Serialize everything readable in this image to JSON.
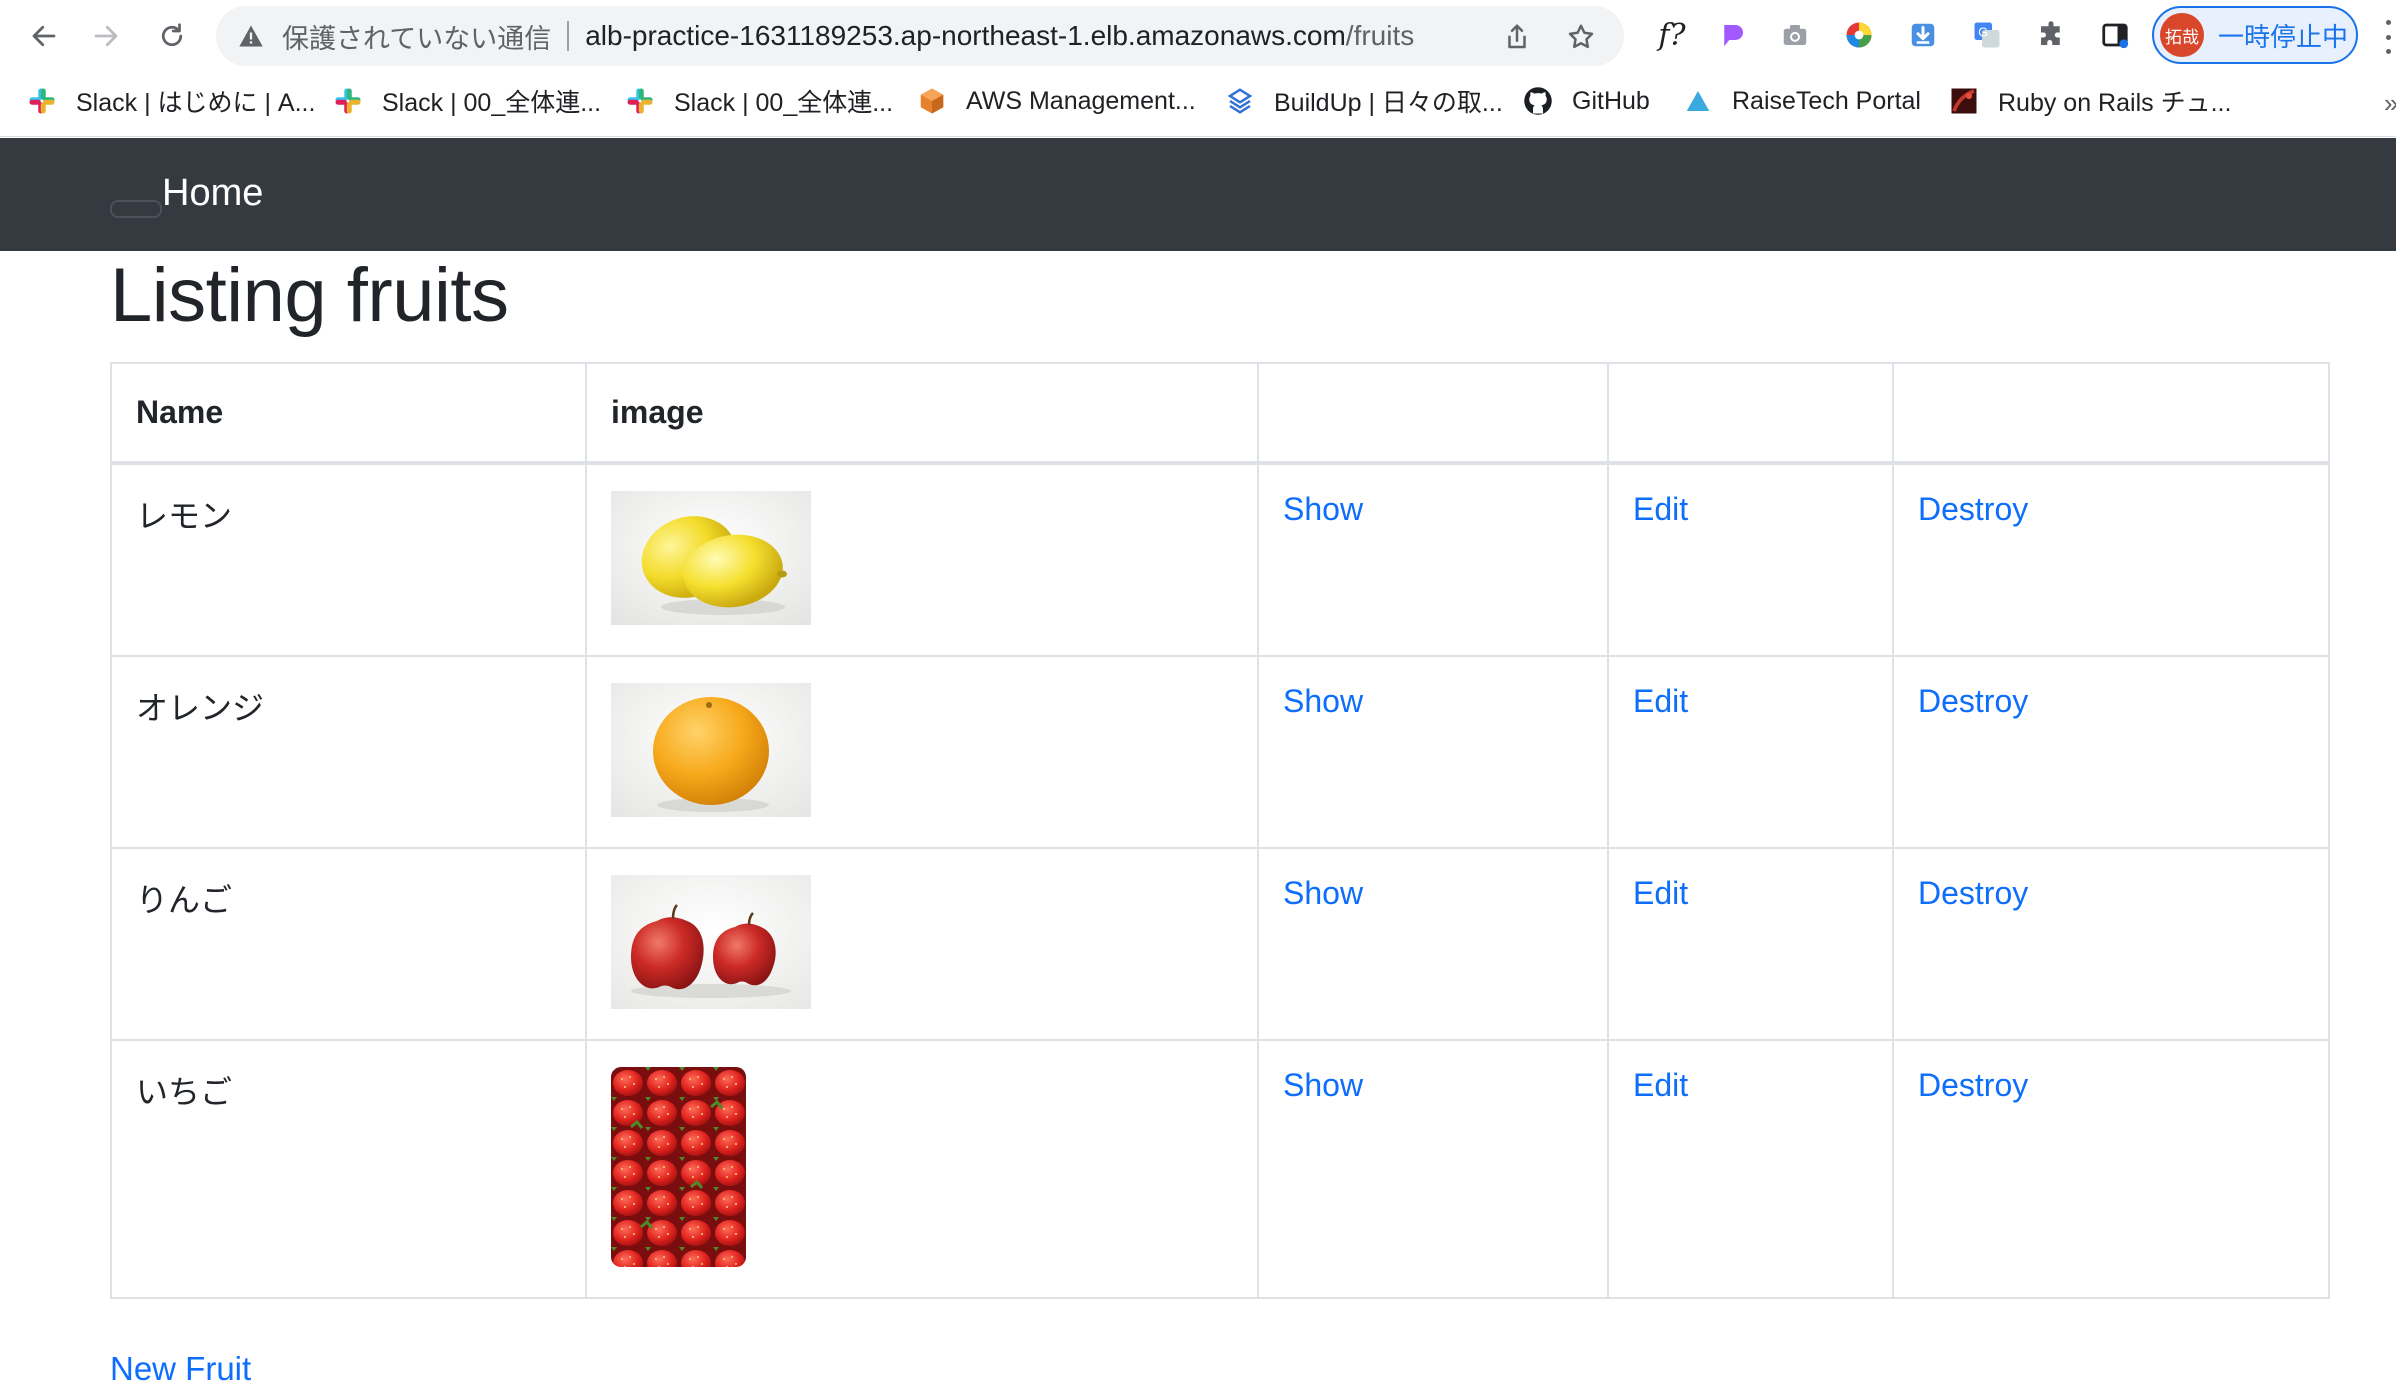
{
  "browser": {
    "security_label": "保護されていない通信",
    "url_host": "alb-practice-1631189253.ap-northeast-1.elb.amazonaws.com",
    "url_path": "/fruits",
    "profile_initials": "拓哉",
    "profile_status": "一時停止中",
    "extensions": [
      "f?"
    ],
    "accent_color": "#1a73e8"
  },
  "bookmarks": [
    {
      "label": "Slack | はじめに | A...",
      "icon": "slack-icon"
    },
    {
      "label": "Slack | 00_全体連...",
      "icon": "slack-icon"
    },
    {
      "label": "Slack | 00_全体連...",
      "icon": "slack-icon"
    },
    {
      "label": "AWS Management...",
      "icon": "aws-cube-icon"
    },
    {
      "label": "BuildUp | 日々の取...",
      "icon": "buildup-icon"
    },
    {
      "label": "GitHub",
      "icon": "github-icon"
    },
    {
      "label": "RaiseTech Portal",
      "icon": "raisetech-icon"
    },
    {
      "label": "Ruby on Rails チュ...",
      "icon": "rails-icon"
    }
  ],
  "navbar": {
    "home_label": "Home",
    "background": "#343a40"
  },
  "page": {
    "title": "Listing fruits",
    "new_link": "New Fruit",
    "link_color": "#0d6efd"
  },
  "table": {
    "headers": [
      "Name",
      "image",
      "",
      "",
      ""
    ],
    "rows": [
      {
        "name": "レモン",
        "image": "lemon-image",
        "show": "Show",
        "edit": "Edit",
        "destroy": "Destroy"
      },
      {
        "name": "オレンジ",
        "image": "orange-image",
        "show": "Show",
        "edit": "Edit",
        "destroy": "Destroy"
      },
      {
        "name": "りんご",
        "image": "apple-image",
        "show": "Show",
        "edit": "Edit",
        "destroy": "Destroy"
      },
      {
        "name": "いちご",
        "image": "strawberry-image",
        "show": "Show",
        "edit": "Edit",
        "destroy": "Destroy"
      }
    ]
  }
}
